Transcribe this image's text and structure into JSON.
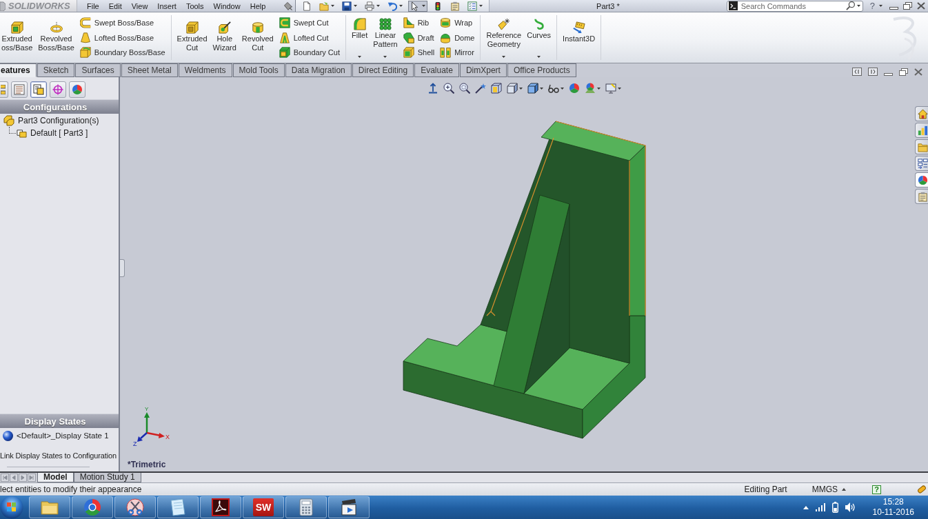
{
  "titlebar": {
    "logo_text": "SOLIDWORKS",
    "menu": [
      "File",
      "Edit",
      "View",
      "Insert",
      "Tools",
      "Window",
      "Help"
    ],
    "quick_access": [
      {
        "dropdown": false,
        "pressed": false
      },
      {
        "dropdown": true,
        "pressed": false
      },
      {
        "dropdown": true,
        "pressed": false
      },
      {
        "dropdown": true,
        "pressed": false
      },
      {
        "dropdown": true,
        "pressed": false
      },
      {
        "dropdown": true,
        "pressed": true
      },
      {
        "dropdown": false,
        "pressed": false
      },
      {
        "dropdown": false,
        "pressed": false
      },
      {
        "dropdown": true,
        "pressed": false
      }
    ],
    "title": "Part3 *",
    "search": {
      "placeholder": "Search Commands"
    },
    "help": "?"
  },
  "ribbon": {
    "groups": [
      {
        "columns": [
          {
            "kind": "large",
            "lines": [
              "Extruded",
              "oss/Base"
            ],
            "dropdown": false
          },
          {
            "kind": "large",
            "lines": [
              "Revolved",
              "Boss/Base"
            ],
            "dropdown": false
          },
          {
            "kind": "stack",
            "items": [
              "Swept Boss/Base",
              "Lofted Boss/Base",
              "Boundary Boss/Base"
            ]
          }
        ]
      },
      {
        "columns": [
          {
            "kind": "large",
            "lines": [
              "Extruded",
              "Cut"
            ],
            "dropdown": false
          },
          {
            "kind": "large",
            "lines": [
              "Hole",
              "Wizard"
            ],
            "dropdown": false
          },
          {
            "kind": "large",
            "lines": [
              "Revolved",
              "Cut"
            ],
            "dropdown": false
          },
          {
            "kind": "stack",
            "items": [
              "Swept Cut",
              "Lofted Cut",
              "Boundary Cut"
            ]
          }
        ]
      },
      {
        "columns": [
          {
            "kind": "large",
            "lines": [
              "Fillet"
            ],
            "dropdown": true
          },
          {
            "kind": "large",
            "lines": [
              "Linear",
              "Pattern"
            ],
            "dropdown": true
          },
          {
            "kind": "stack",
            "items": [
              "Rib",
              "Draft",
              "Shell"
            ]
          },
          {
            "kind": "stack",
            "items": [
              "Wrap",
              "Dome",
              "Mirror"
            ]
          }
        ]
      },
      {
        "columns": [
          {
            "kind": "large",
            "lines": [
              "Reference",
              "Geometry"
            ],
            "dropdown": true
          },
          {
            "kind": "large",
            "lines": [
              "Curves"
            ],
            "dropdown": true
          }
        ]
      },
      {
        "columns": [
          {
            "kind": "large",
            "lines": [
              "Instant3D"
            ],
            "dropdown": false
          }
        ]
      }
    ]
  },
  "tabs": [
    {
      "label": "eatures",
      "selected": true
    },
    {
      "label": "Sketch",
      "selected": false
    },
    {
      "label": "Surfaces",
      "selected": false
    },
    {
      "label": "Sheet Metal",
      "selected": false
    },
    {
      "label": "Weldments",
      "selected": false
    },
    {
      "label": "Mold Tools",
      "selected": false
    },
    {
      "label": "Data Migration",
      "selected": false
    },
    {
      "label": "Direct Editing",
      "selected": false
    },
    {
      "label": "Evaluate",
      "selected": false
    },
    {
      "label": "DimXpert",
      "selected": false
    },
    {
      "label": "Office Products",
      "selected": false
    }
  ],
  "feature_manager": {
    "tabs": [
      {
        "selected": false
      },
      {
        "selected": false
      },
      {
        "selected": true
      },
      {
        "selected": false
      },
      {
        "selected": false
      }
    ],
    "configurations": {
      "header": "Configurations",
      "tree": [
        {
          "label": "Part3 Configuration(s)",
          "children": [
            {
              "label": "Default [ Part3 ]"
            }
          ]
        }
      ]
    },
    "display_states": {
      "header": "Display States",
      "items": [
        {
          "label": "<Default>_Display State 1"
        }
      ],
      "link_label": "Link Display States to Configuration"
    }
  },
  "viewport": {
    "view_toolbar": [
      {
        "dropdown": false
      },
      {
        "dropdown": false
      },
      {
        "dropdown": false
      },
      {
        "dropdown": false
      },
      {
        "dropdown": false
      },
      {
        "dropdown": true
      },
      {
        "dropdown": true
      },
      {
        "dropdown": true
      },
      {
        "dropdown": false
      },
      {
        "dropdown": true
      },
      {
        "dropdown": true
      }
    ],
    "triad": {
      "x": "X",
      "y": "Y",
      "z": "Z"
    },
    "view_name": "*Trimetric",
    "task_pane_tabs": [
      {
        "selected": false
      },
      {
        "selected": false
      },
      {
        "selected": false
      },
      {
        "selected": false
      },
      {
        "selected": true
      },
      {
        "selected": false
      }
    ]
  },
  "bottom_tabs": [
    {
      "label": "Model",
      "selected": true
    },
    {
      "label": "Motion Study 1",
      "selected": false
    }
  ],
  "status_bar": {
    "message": "lect entities to modify their appearance",
    "mode": "Editing Part",
    "units": "MMGS",
    "help": "?"
  },
  "taskbar": {
    "app_tile_text": "SW",
    "time": "15:28",
    "date": "10-11-2016"
  }
}
